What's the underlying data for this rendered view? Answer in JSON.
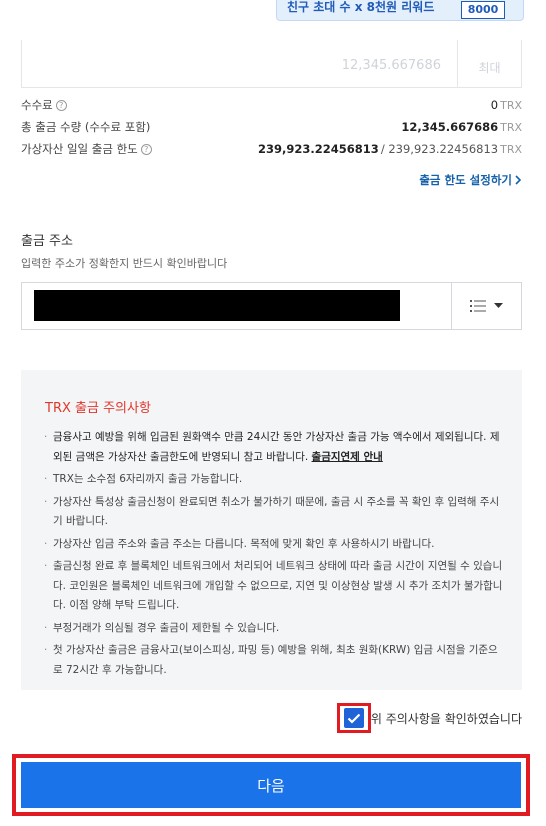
{
  "banner": {
    "text": "친구 초대 수 x 8천원 리워드",
    "badge": "8000"
  },
  "amount": {
    "value": "12,345.667686",
    "max_label": "최대"
  },
  "fee": {
    "label": "수수료",
    "value": "0",
    "unit": "TRX"
  },
  "total": {
    "label": "총 출금 수량 (수수료 포함)",
    "value": "12,345.667686",
    "unit": "TRX"
  },
  "daily_limit": {
    "label": "가상자산 일일 출금 한도",
    "used": "239,923.22456813",
    "total": "/ 239,923.22456813",
    "unit": "TRX"
  },
  "limit_link": "출금 한도 설정하기",
  "address": {
    "title": "출금 주소",
    "hint": "입력한 주소가 정확한지 반드시 확인바랍니다"
  },
  "notice": {
    "title": "TRX 출금 주의사항",
    "item1": "금융사고 예방을 위해 입금된 원화액수 만큼 24시간 동안 가상자산 출금 가능 액수에서 제외됩니다. 제외된 금액은 가상자산 출금한도에 반영되니 참고 바랍니다.",
    "item1_link": "출금지연제 안내",
    "item2": "TRX는 소수점 6자리까지 출금 가능합니다.",
    "item3": "가상자산 특성상 출금신청이 완료되면 취소가 불가하기 때문에, 출금 시 주소를 꼭 확인 후 입력해 주시기 바랍니다.",
    "item4": "가상자산 입금 주소와 출금 주소는 다릅니다. 목적에 맞게 확인 후 사용하시기 바랍니다.",
    "item5": "출금신청 완료 후 블록체인 네트워크에서 처리되어 네트워크 상태에 따라 출금 시간이 지연될 수 있습니다. 코인원은 블록체인 네트워크에 개입할 수 없으므로, 지연 및 이상현상 발생 시 추가 조치가 불가합니다. 이점 양해 부탁 드립니다.",
    "item6": "부정거래가 의심될 경우 출금이 제한될 수 있습니다.",
    "item7": "첫 가상자산 출금은 금융사고(보이스피싱, 파밍 등) 예방을 위해, 최초 원화(KRW) 입금 시점을 기준으로 72시간 후 가능합니다."
  },
  "confirm_label": "위 주의사항을 확인하였습니다",
  "next_button": "다음",
  "colors": {
    "primary": "#1a73e8",
    "highlight": "#e11b22",
    "warning_title": "#e0372c"
  }
}
